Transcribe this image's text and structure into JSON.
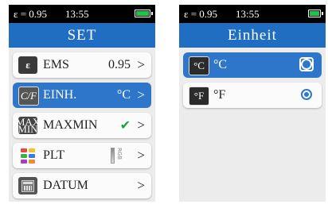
{
  "left_screen": {
    "status": {
      "emissivity": "ε = 0.95",
      "time": "13:55"
    },
    "title": "SET",
    "items": [
      {
        "label": "EMS",
        "value": "0.95",
        "chevron": ">",
        "icon": "ems-icon",
        "icon_text": "ε"
      },
      {
        "label": "EINH.",
        "value": "°C",
        "chevron": ">",
        "icon": "celsius-fahrenheit-icon",
        "icon_text": "C/F",
        "selected": true
      },
      {
        "label": "MAXMIN",
        "value": "✔",
        "chevron": ">",
        "icon": "maxmin-icon",
        "icon_text": "MAX MIN"
      },
      {
        "label": "PLT",
        "value": "RGB",
        "chevron": ">",
        "icon": "palette-icon"
      },
      {
        "label": "DATUM",
        "value": "",
        "chevron": ">",
        "icon": "calendar-icon"
      }
    ]
  },
  "right_screen": {
    "status": {
      "emissivity": "ε = 0.95",
      "time": "13:55"
    },
    "title": "Einheit",
    "options": [
      {
        "icon_text": "°C",
        "label": "°C",
        "selected": true
      },
      {
        "icon_text": "°F",
        "label": "°F",
        "checked": true
      }
    ]
  },
  "colors": {
    "accent_blue": "#1f6ec2",
    "highlight_blue": "#2d76c9",
    "check_green": "#1aa33a",
    "battery_green": "#22c24a"
  }
}
